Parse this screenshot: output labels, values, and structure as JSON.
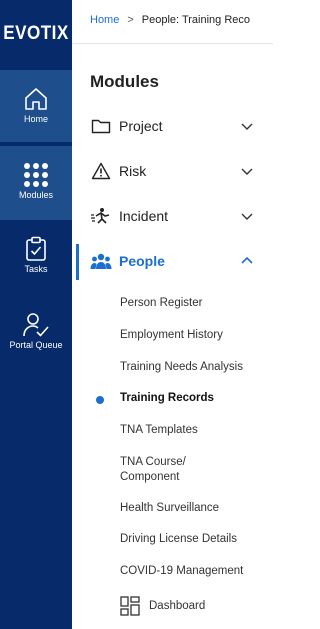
{
  "brand": {
    "logo_text": "EVOTIX"
  },
  "rail": {
    "home_label": "Home",
    "modules_label": "Modules",
    "tasks_label": "Tasks",
    "portal_queue_label": "Portal Queue"
  },
  "breadcrumb": {
    "home": "Home",
    "separator": ">",
    "current": "People: Training Reco"
  },
  "modules": {
    "title": "Modules",
    "items": [
      {
        "label": "Project",
        "icon": "folder-icon"
      },
      {
        "label": "Risk",
        "icon": "warning-icon"
      },
      {
        "label": "Incident",
        "icon": "incident-icon"
      },
      {
        "label": "People",
        "icon": "people-icon"
      }
    ],
    "people_submenu": [
      {
        "label": "Person Register"
      },
      {
        "label": "Employment History"
      },
      {
        "label": "Training Needs Analysis"
      },
      {
        "label": "Training Records"
      },
      {
        "label": "TNA Templates"
      },
      {
        "label": "TNA Course/\nComponent"
      },
      {
        "label": "Health Surveillance"
      },
      {
        "label": "Driving License Details"
      },
      {
        "label": "COVID-19 Management"
      },
      {
        "label": "Dashboard",
        "icon": "dashboard-icon"
      }
    ]
  },
  "colors": {
    "rail_bg": "#072a6b",
    "rail_active_bg": "#1e4e8c",
    "accent": "#1a6fd0"
  }
}
